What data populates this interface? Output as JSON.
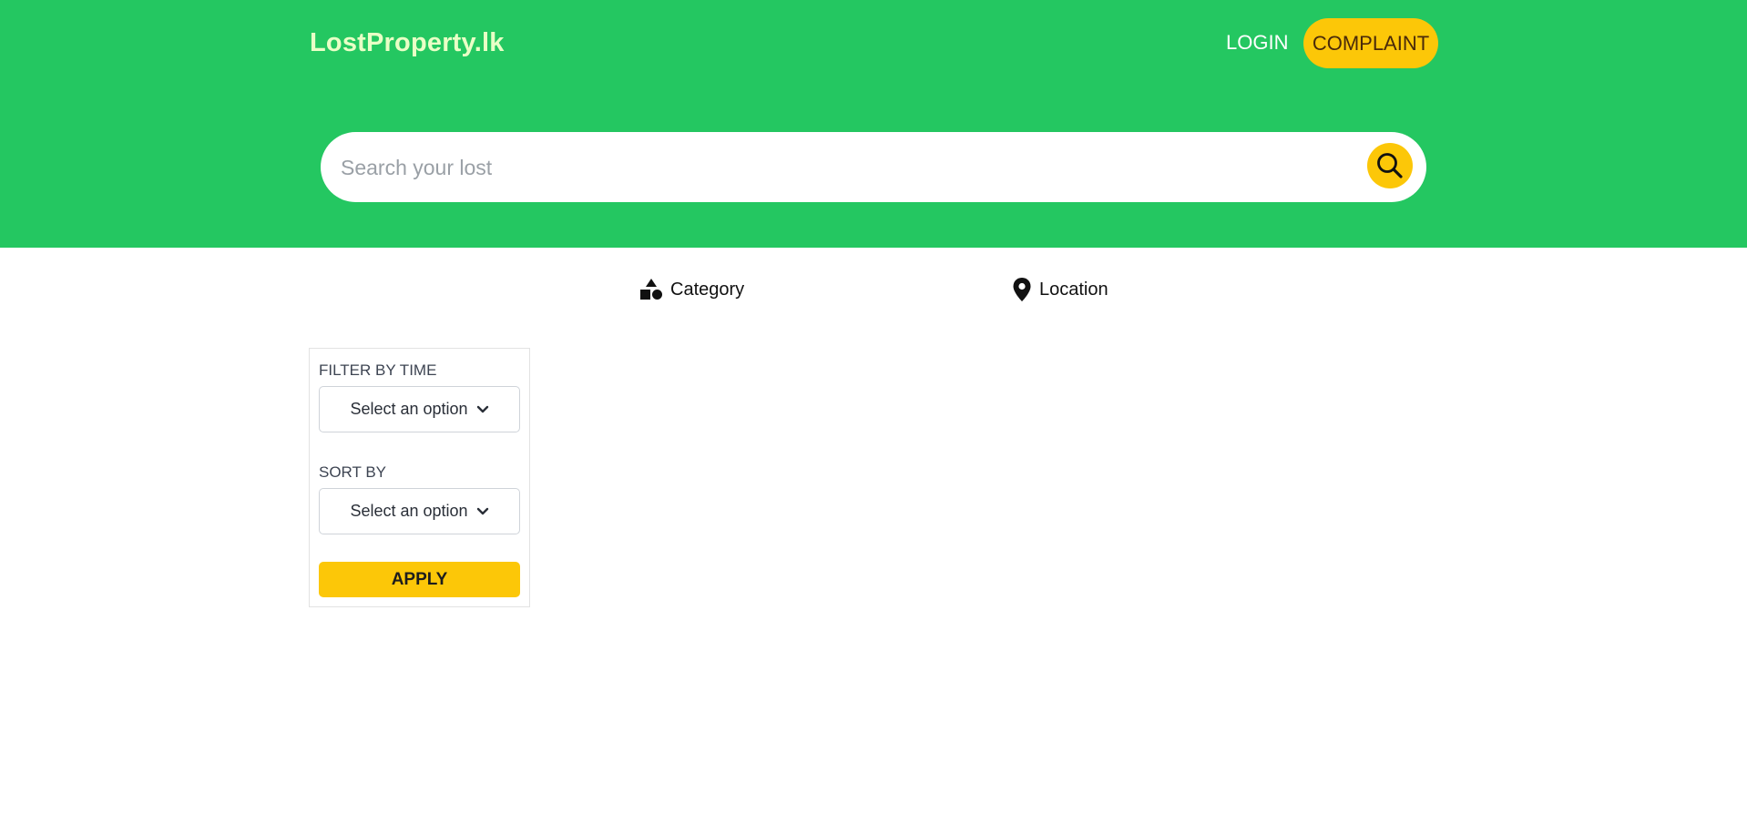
{
  "header": {
    "brand": "LostProperty.lk",
    "login_label": "LOGIN",
    "complaint_label": "COMPLAINT"
  },
  "search": {
    "placeholder": "Search your lost",
    "value": "",
    "icon": "search-icon"
  },
  "tabs": [
    {
      "label": "Category",
      "icon": "shapes-icon"
    },
    {
      "label": "Location",
      "icon": "map-pin-icon"
    }
  ],
  "filters": {
    "time_label": "FILTER BY TIME",
    "time_selected": "Select an option",
    "sort_label": "SORT BY",
    "sort_selected": "Select an option",
    "apply_label": "APPLY"
  },
  "colors": {
    "hero_green": "#24c761",
    "accent_yellow": "#fcc708",
    "brand_text": "#e9ffc6"
  }
}
